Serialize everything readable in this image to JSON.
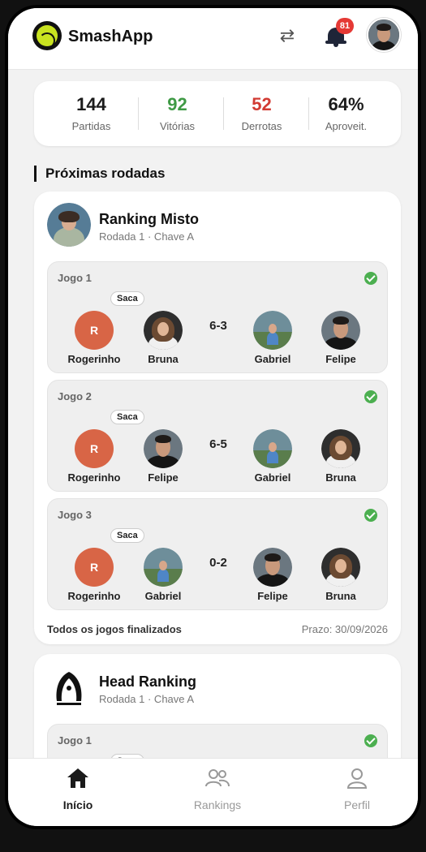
{
  "header": {
    "app_name": "SmashApp",
    "notification_count": "81"
  },
  "stats": [
    {
      "value": "144",
      "label": "Partidas",
      "color": "#1b1b1b"
    },
    {
      "value": "92",
      "label": "Vitórias",
      "color": "#3f9a45"
    },
    {
      "value": "52",
      "label": "Derrotas",
      "color": "#d23b33"
    },
    {
      "value": "64%",
      "label": "Aproveit.",
      "color": "#1b1b1b"
    }
  ],
  "section_title": "Próximas rodadas",
  "cards": [
    {
      "title": "Ranking Misto",
      "subtitle": "Rodada 1 · Chave A",
      "games": [
        {
          "label": "Jogo 1",
          "serve": "Saca",
          "score": "6-3",
          "p1": "Rogerinho",
          "p1_initial": "R",
          "p2": "Bruna",
          "p3": "Gabriel",
          "p4": "Felipe"
        },
        {
          "label": "Jogo 2",
          "serve": "Saca",
          "score": "6-5",
          "p1": "Rogerinho",
          "p1_initial": "R",
          "p2": "Felipe",
          "p3": "Gabriel",
          "p4": "Bruna"
        },
        {
          "label": "Jogo 3",
          "serve": "Saca",
          "score": "0-2",
          "p1": "Rogerinho",
          "p1_initial": "R",
          "p2": "Gabriel",
          "p3": "Felipe",
          "p4": "Bruna"
        }
      ],
      "footer_status": "Todos os jogos finalizados",
      "footer_deadline": "Prazo: 30/09/2026"
    },
    {
      "title": "Head Ranking",
      "subtitle": "Rodada 1 · Chave A",
      "games": [
        {
          "label": "Jogo 1",
          "serve": "Saca"
        }
      ]
    }
  ],
  "nav": [
    {
      "label": "Início",
      "icon": "home-icon",
      "active": true
    },
    {
      "label": "Rankings",
      "icon": "people-icon",
      "active": false
    },
    {
      "label": "Perfil",
      "icon": "user-icon",
      "active": false
    }
  ]
}
